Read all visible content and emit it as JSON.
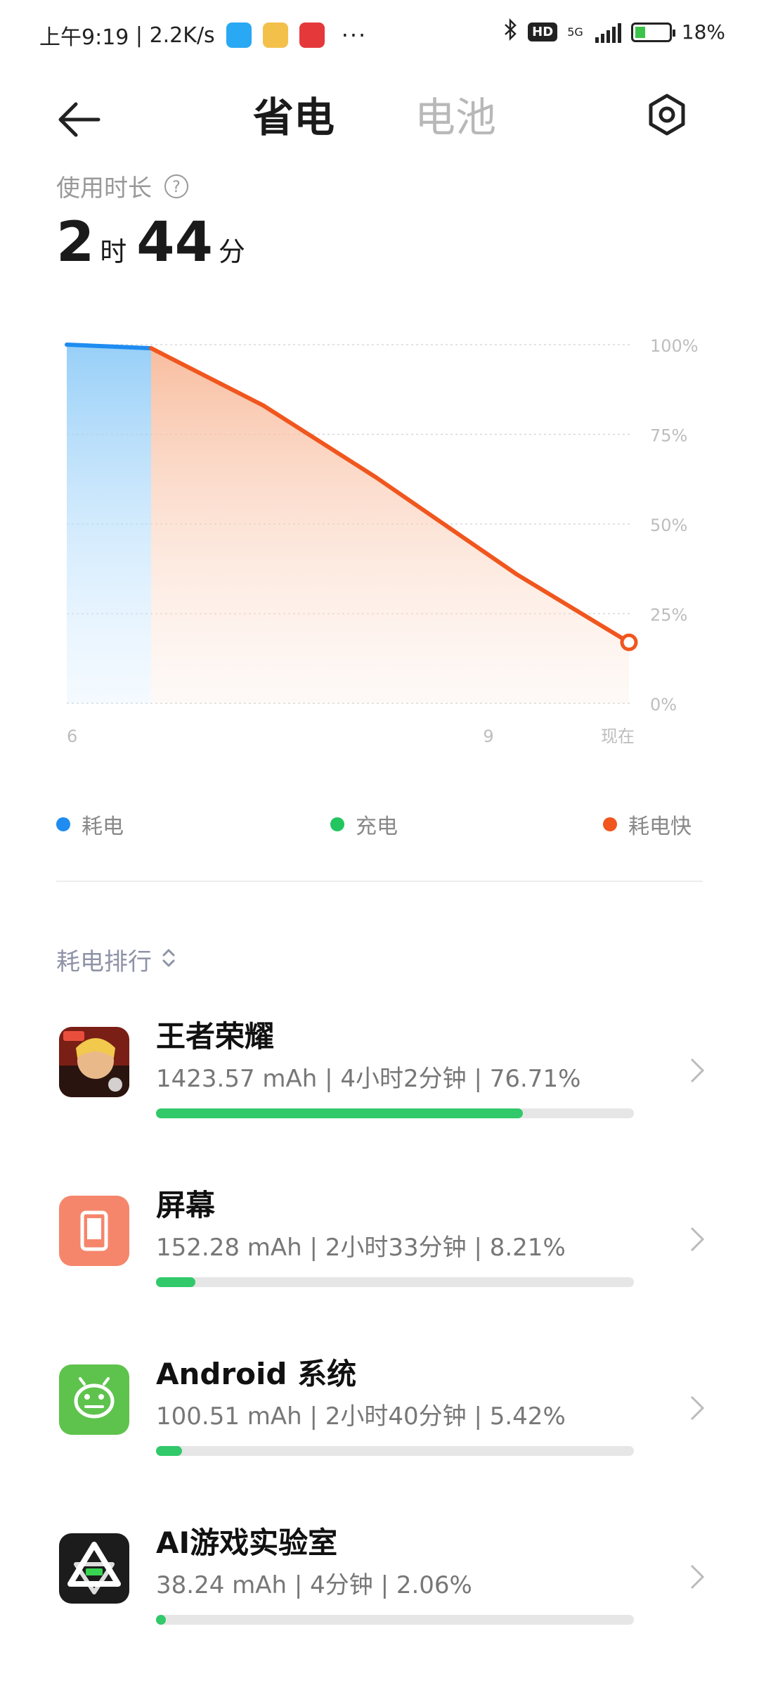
{
  "status_bar": {
    "time": "上午9:19",
    "speed": "2.2K/s",
    "more": "···",
    "network": "5G",
    "hd": "HD",
    "battery": "18%"
  },
  "header": {
    "tabs": [
      "省电",
      "电池"
    ],
    "active_tab": "省电"
  },
  "usage": {
    "label": "使用时长",
    "help": "?",
    "hours": "2",
    "hours_unit": "时",
    "minutes": "44",
    "minutes_unit": "分"
  },
  "chart_data": {
    "type": "area",
    "x_ticks": [
      "6",
      "9",
      "现在"
    ],
    "y_ticks": [
      "100%",
      "75%",
      "50%",
      "25%",
      "0%"
    ],
    "ylim": [
      0,
      100
    ],
    "grid": true,
    "series": [
      {
        "name": "耗电",
        "color": "#1e8cf0",
        "points": [
          [
            0,
            100
          ],
          [
            0.15,
            99
          ]
        ]
      },
      {
        "name": "耗电快",
        "color": "#f0561e",
        "points": [
          [
            0.15,
            99
          ],
          [
            0.35,
            83
          ],
          [
            0.55,
            63
          ],
          [
            0.8,
            36
          ],
          [
            1.0,
            17
          ]
        ]
      }
    ]
  },
  "legend": [
    {
      "label": "耗电",
      "color": "#1e8cf0"
    },
    {
      "label": "充电",
      "color": "#22c55e"
    },
    {
      "label": "耗电快",
      "color": "#f0561e"
    }
  ],
  "ranking": {
    "title": "耗电排行",
    "items": [
      {
        "name": "王者荣耀",
        "detail": "1423.57 mAh | 4小时2分钟 | 76.71%",
        "percent": 76.71,
        "icon": "game-icon"
      },
      {
        "name": "屏幕",
        "detail": "152.28 mAh | 2小时33分钟 | 8.21%",
        "percent": 8.21,
        "icon": "screen-icon"
      },
      {
        "name": "Android 系统",
        "detail": "100.51 mAh | 2小时40分钟 | 5.42%",
        "percent": 5.42,
        "icon": "android-icon"
      },
      {
        "name": "AI游戏实验室",
        "detail": "38.24 mAh | 4分钟 | 2.06%",
        "percent": 2.06,
        "icon": "ai-lab-icon"
      }
    ]
  }
}
